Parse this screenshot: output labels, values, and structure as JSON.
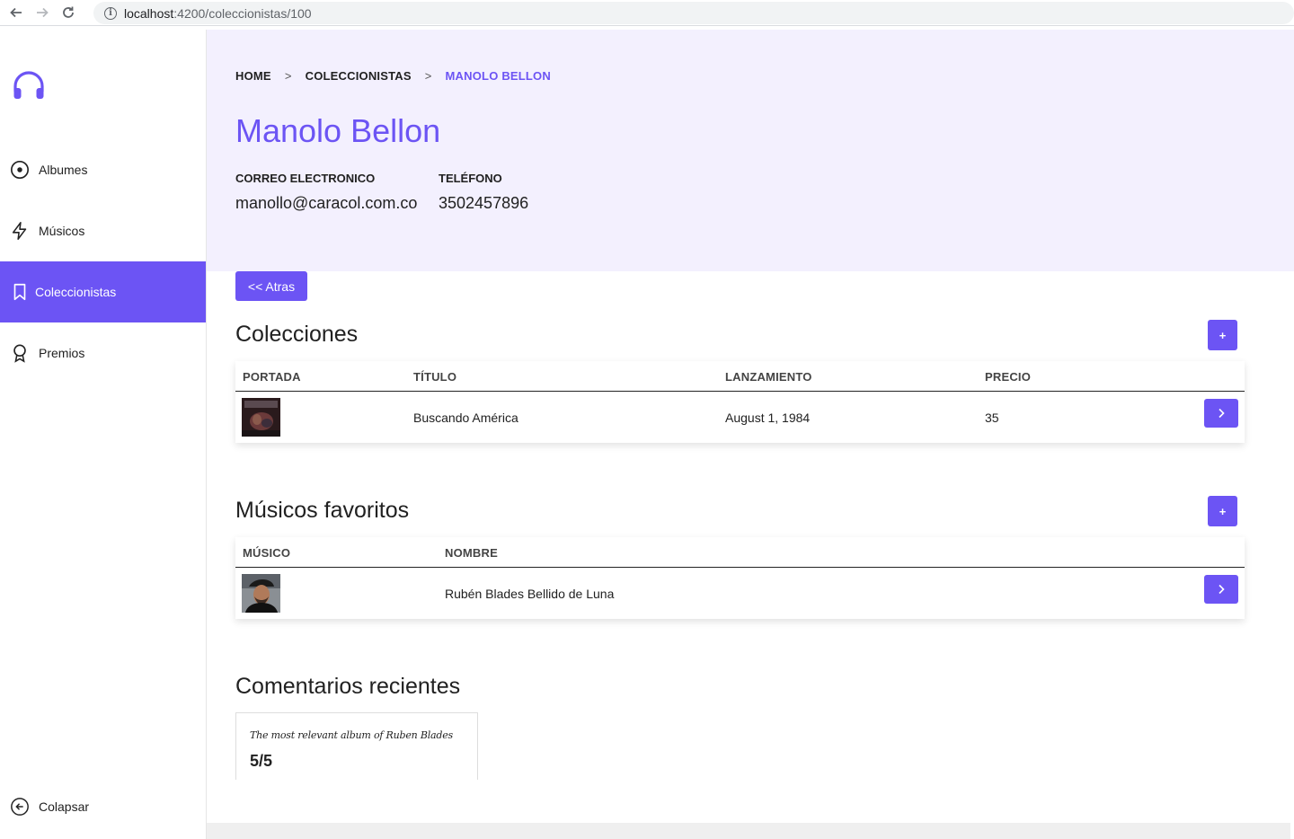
{
  "browser": {
    "url_host": "localhost",
    "url_path": ":4200/coleccionistas/100"
  },
  "sidebar": {
    "items": [
      {
        "label": "Albumes",
        "icon": "disc-icon"
      },
      {
        "label": "Músicos",
        "icon": "lightning-icon"
      },
      {
        "label": "Coleccionistas",
        "icon": "bookmark-icon",
        "active": true
      },
      {
        "label": "Premios",
        "icon": "award-icon"
      }
    ],
    "collapse_label": "Colapsar"
  },
  "breadcrumb": {
    "home": "HOME",
    "sep": ">",
    "section": "COLECCIONISTAS",
    "current": "MANOLO BELLON"
  },
  "collector": {
    "name": "Manolo Bellon",
    "email_label": "CORREO ELECTRONICO",
    "email": "manollo@caracol.com.co",
    "phone_label": "TELÉFONO",
    "phone": "3502457896"
  },
  "back_label": "<< Atras",
  "colecciones": {
    "title": "Colecciones",
    "add_label": "+",
    "headers": [
      "PORTADA",
      "TÍTULO",
      "LANZAMIENTO",
      "PRECIO"
    ],
    "rows": [
      {
        "title": "Buscando América",
        "release": "August 1, 1984",
        "price": "35"
      }
    ]
  },
  "musicos": {
    "title": "Músicos favoritos",
    "add_label": "+",
    "headers": [
      "MÚSICO",
      "NOMBRE"
    ],
    "rows": [
      {
        "name": "Rubén Blades Bellido de Luna"
      }
    ]
  },
  "comentarios": {
    "title": "Comentarios recientes",
    "items": [
      {
        "text": "The most relevant album of Ruben Blades",
        "score": "5/5"
      }
    ]
  },
  "colors": {
    "accent": "#6c54f4",
    "hero_bg": "#f3f0fe"
  }
}
